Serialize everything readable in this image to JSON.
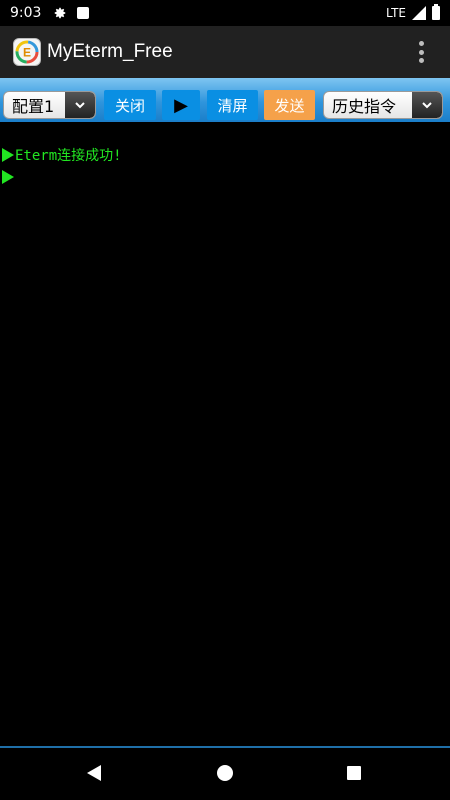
{
  "status_bar": {
    "time": "9:03",
    "network": "LTE",
    "icons": [
      "gear-icon",
      "notification-square-icon",
      "signal-icon",
      "battery-icon"
    ]
  },
  "app_bar": {
    "title": "MyEterm_Free",
    "logo_letter": "E"
  },
  "toolbar": {
    "config_select": "配置1",
    "close_label": "关闭",
    "play_label": "▶",
    "clear_label": "清屏",
    "send_label": "发送",
    "history_select": "历史指令"
  },
  "terminal": {
    "lines": [
      {
        "text": "Eterm连接成功!"
      },
      {
        "text": ""
      }
    ]
  },
  "colors": {
    "terminal_text": "#22e622",
    "toolbar_button": "#0a8fe3",
    "send_button": "#f5a14a",
    "app_bar": "#212121"
  }
}
